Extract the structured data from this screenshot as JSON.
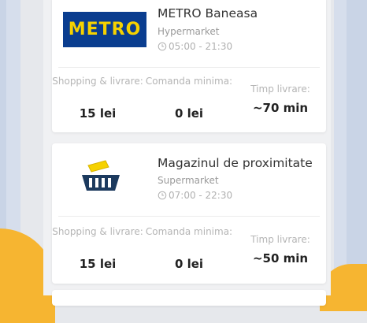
{
  "stores": [
    {
      "name": "METRO Baneasa",
      "logo_text": "METRO",
      "type": "Hypermarket",
      "hours": "05:00 - 21:30",
      "stats": [
        {
          "label": "Shopping & livrare:",
          "value": "15 lei"
        },
        {
          "label": "Comanda minima:",
          "value": "0 lei"
        },
        {
          "label": "Timp livrare:",
          "value": "~70 min"
        }
      ]
    },
    {
      "name": "Magazinul de proximitate",
      "type": "Supermarket",
      "hours": "07:00 - 22:30",
      "stats": [
        {
          "label": "Shopping & livrare:",
          "value": "15 lei"
        },
        {
          "label": "Comanda minima:",
          "value": "0 lei"
        },
        {
          "label": "Timp livrare:",
          "value": "~50 min"
        }
      ]
    }
  ],
  "colors": {
    "metro_blue": "#0a3d8f",
    "metro_yellow": "#f6d200",
    "accent_yellow": "#f6b531",
    "basket_blue": "#1c3a5e"
  },
  "icons": [
    "clock-icon",
    "basket-icon"
  ]
}
